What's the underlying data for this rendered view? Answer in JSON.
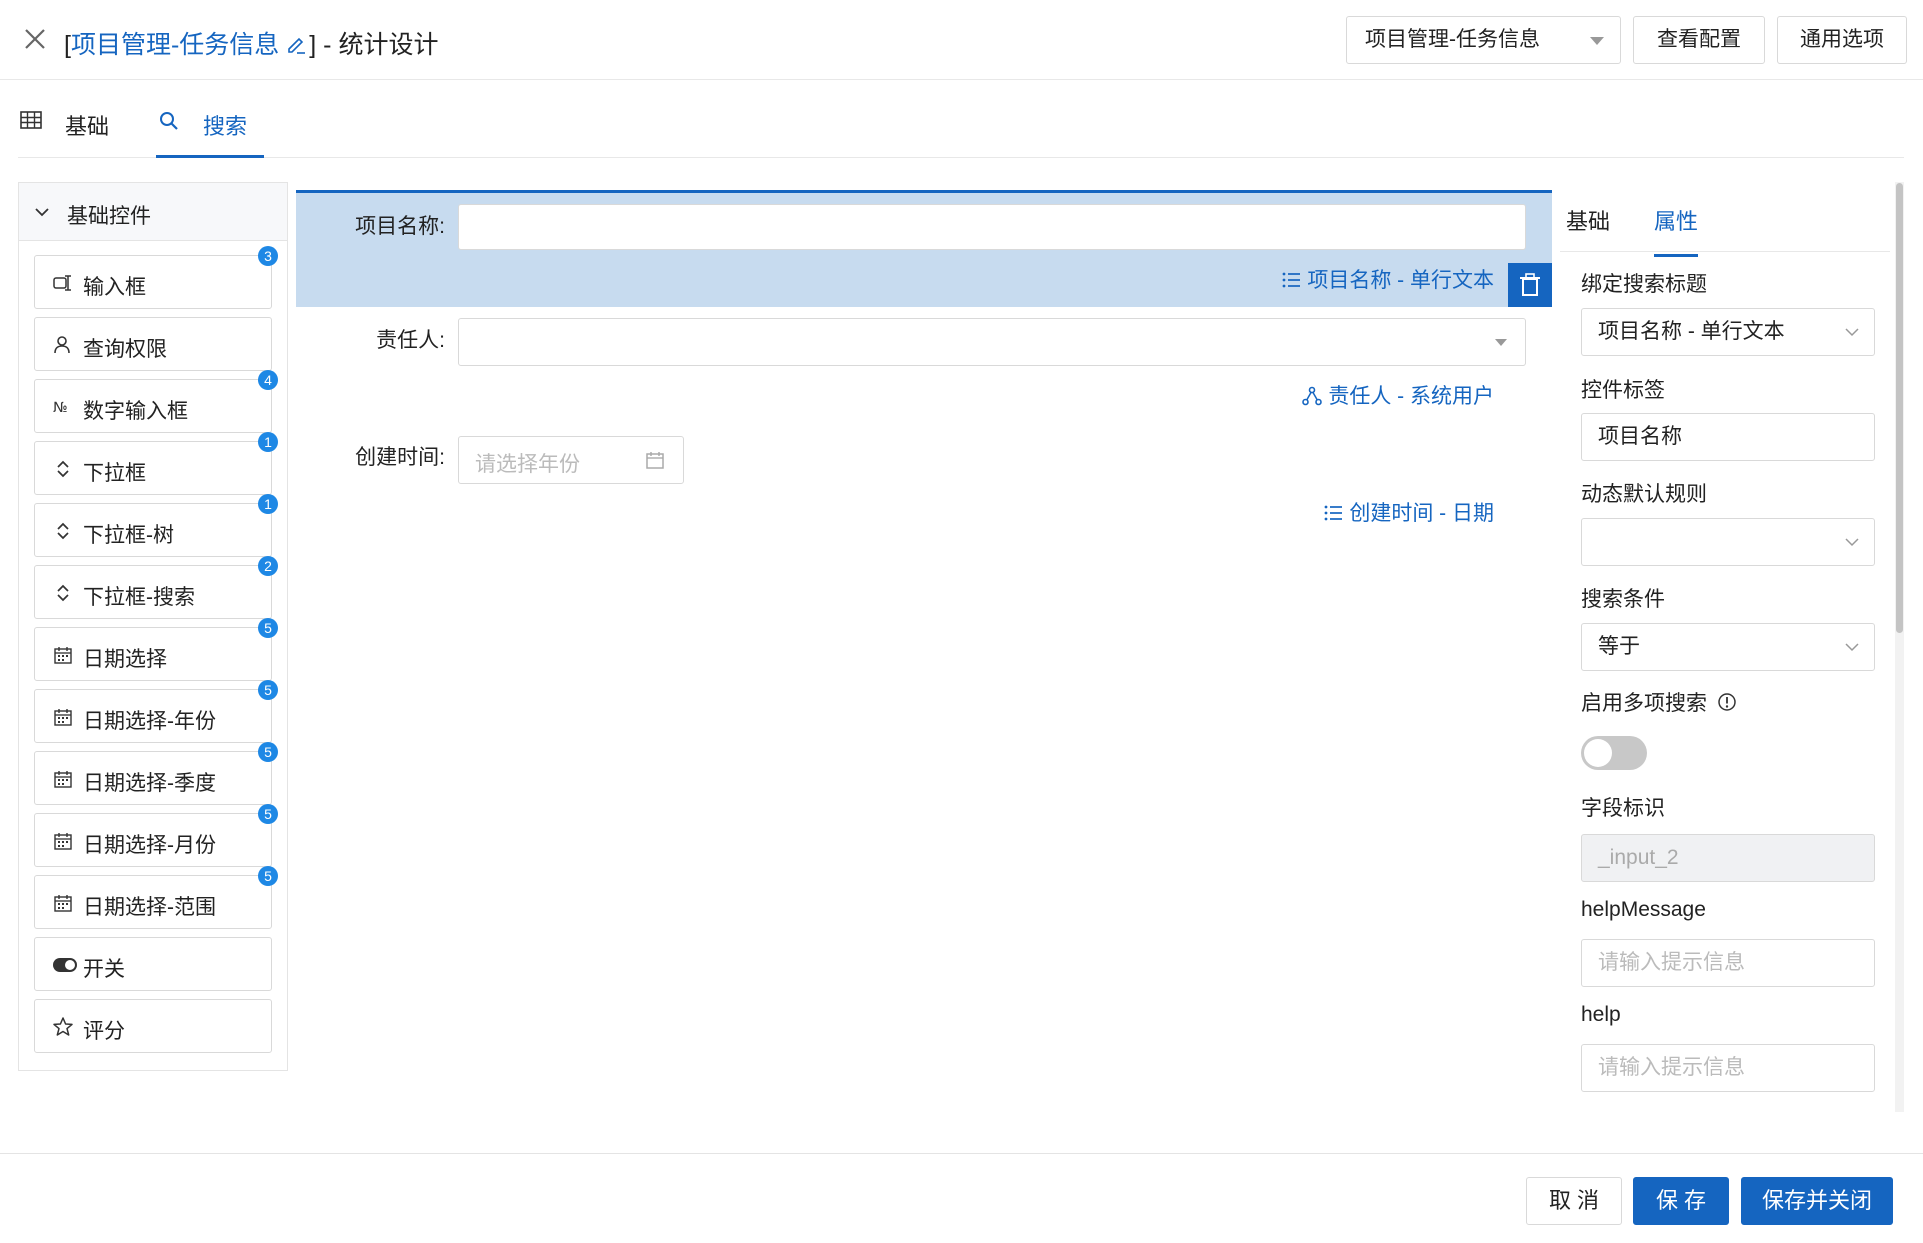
{
  "header": {
    "title_prefix": "[",
    "title_link": "项目管理-任务信息",
    "title_suffix": "] - 统计设计",
    "form_select": "项目管理-任务信息",
    "view_config_label": "查看配置",
    "general_options_label": "通用选项"
  },
  "top_tabs": [
    {
      "label": "基础",
      "icon": "table-icon"
    },
    {
      "label": "搜索",
      "icon": "search-icon",
      "active": true
    }
  ],
  "left_panel": {
    "group_title": "基础控件",
    "controls": [
      {
        "label": "输入框",
        "icon": "input-icon",
        "badge": "3"
      },
      {
        "label": "查询权限",
        "icon": "user-icon",
        "badge": ""
      },
      {
        "label": "数字输入框",
        "icon": "number-icon",
        "badge": "4"
      },
      {
        "label": "下拉框",
        "icon": "updown-icon",
        "badge": "1"
      },
      {
        "label": "下拉框-树",
        "icon": "updown-icon",
        "badge": "1"
      },
      {
        "label": "下拉框-搜索",
        "icon": "updown-icon",
        "badge": "2"
      },
      {
        "label": "日期选择",
        "icon": "calendar-icon",
        "badge": "5"
      },
      {
        "label": "日期选择-年份",
        "icon": "calendar-icon",
        "badge": "5"
      },
      {
        "label": "日期选择-季度",
        "icon": "calendar-icon",
        "badge": "5"
      },
      {
        "label": "日期选择-月份",
        "icon": "calendar-icon",
        "badge": "5"
      },
      {
        "label": "日期选择-范围",
        "icon": "calendar-icon",
        "badge": "5"
      },
      {
        "label": "开关",
        "icon": "switch-icon",
        "badge": ""
      },
      {
        "label": "评分",
        "icon": "star-icon",
        "badge": ""
      }
    ]
  },
  "canvas": {
    "fields": [
      {
        "label": "项目名称:",
        "meta": "项目名称 - 单行文本",
        "value": ""
      },
      {
        "label": "责任人:",
        "meta": "责任人 - 系统用户",
        "value": ""
      },
      {
        "label": "创建时间:",
        "meta": "创建时间 - 日期",
        "placeholder": "请选择年份"
      }
    ]
  },
  "right_panel": {
    "tabs": [
      "基础",
      "属性"
    ],
    "active_tab": "属性",
    "bind_title_label": "绑定搜索标题",
    "bind_title_value": "项目名称 - 单行文本",
    "control_label_label": "控件标签",
    "control_label_value": "项目名称",
    "dynamic_default_label": "动态默认规则",
    "dynamic_default_value": "",
    "search_condition_label": "搜索条件",
    "search_condition_value": "等于",
    "multi_search_label": "启用多项搜索",
    "multi_search_enabled": false,
    "field_id_label": "字段标识",
    "field_id_value": "_input_2",
    "help_message_label": "helpMessage",
    "help_message_placeholder": "请输入提示信息",
    "help_label": "help",
    "help_placeholder": "请输入提示信息"
  },
  "footer": {
    "cancel_label": "取 消",
    "save_label": "保 存",
    "save_close_label": "保存并关闭"
  },
  "colors": {
    "primary": "#1565c0",
    "selected_bg": "#c7dbef",
    "badge": "#1e88e5"
  }
}
